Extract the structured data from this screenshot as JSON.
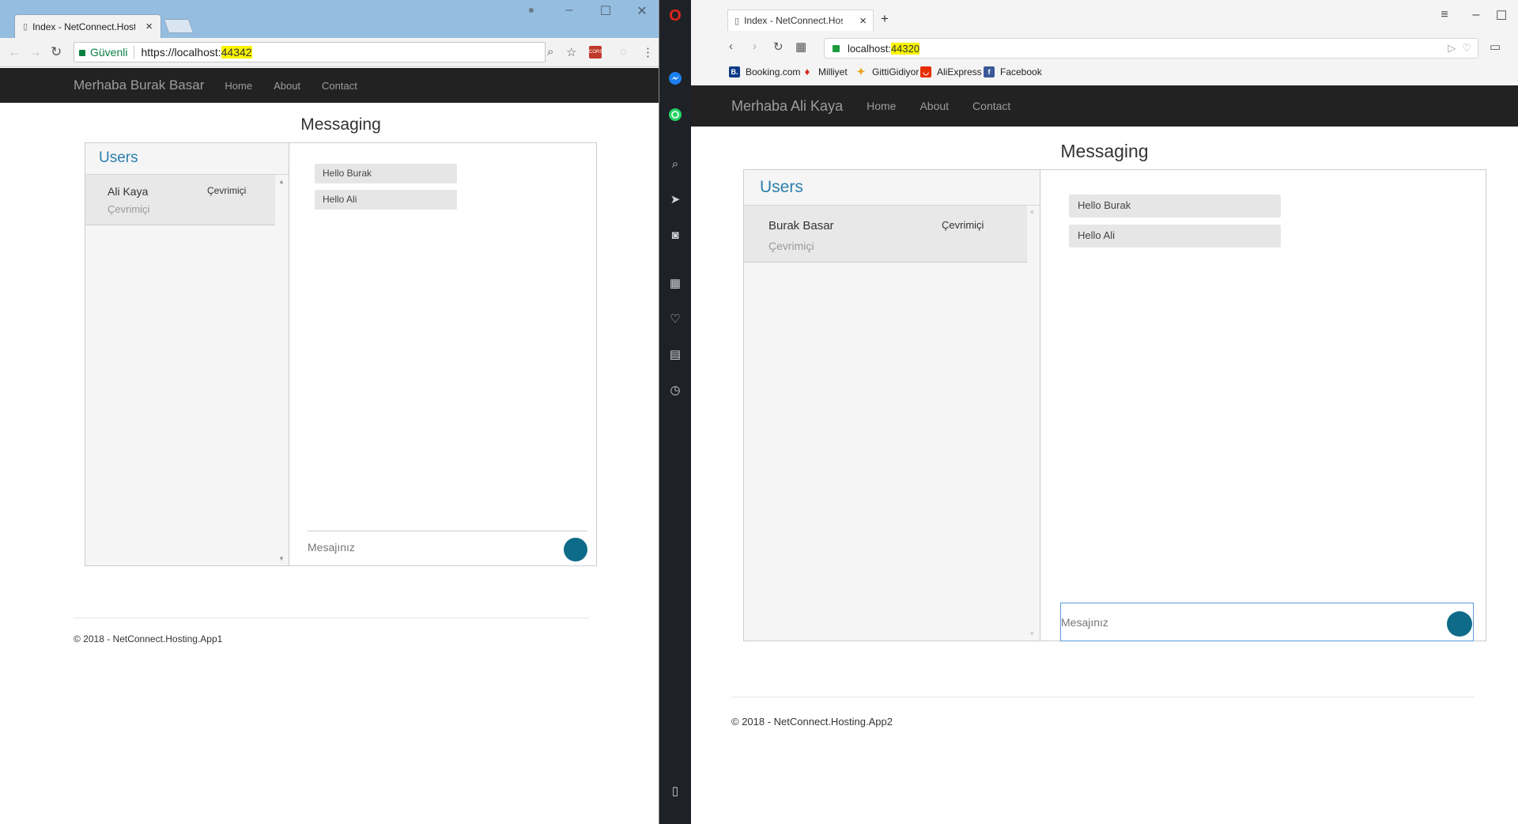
{
  "chrome": {
    "tab_title": "Index - NetConnect.Hosti",
    "security_label": "Güvenli",
    "url_prefix": "https://localhost:",
    "url_port": "44342",
    "navbar": {
      "brand": "Merhaba Burak Basar",
      "links": [
        "Home",
        "About",
        "Contact"
      ]
    },
    "heading": "Messaging",
    "users_title": "Users",
    "user": {
      "name": "Ali Kaya",
      "status": "Çevrimiçi",
      "status_right": "Çevrimiçi"
    },
    "messages": [
      "Hello Burak",
      "Hello Ali"
    ],
    "input_placeholder": "Mesajınız",
    "footer": "© 2018 - NetConnect.Hosting.App1"
  },
  "opera": {
    "tab_title": "Index - NetConnect.Hostin",
    "url_prefix": "localhost:",
    "url_port": "44320",
    "bookmarks": [
      "Booking.com",
      "Milliyet",
      "GittiGidiyor",
      "AliExpress",
      "Facebook"
    ],
    "navbar": {
      "brand": "Merhaba Ali Kaya",
      "links": [
        "Home",
        "About",
        "Contact"
      ]
    },
    "heading": "Messaging",
    "users_title": "Users",
    "user": {
      "name": "Burak Basar",
      "status": "Çevrimiçi",
      "status_right": "Çevrimiçi"
    },
    "messages": [
      "Hello Burak",
      "Hello Ali"
    ],
    "input_placeholder": "Mesajınız",
    "footer": "© 2018 - NetConnect.Hosting.App2"
  },
  "colors": {
    "navbar": "#222222",
    "accent": "#2a7fae",
    "send_button": "#0e6b8a",
    "url_highlight": "#f8f400"
  }
}
